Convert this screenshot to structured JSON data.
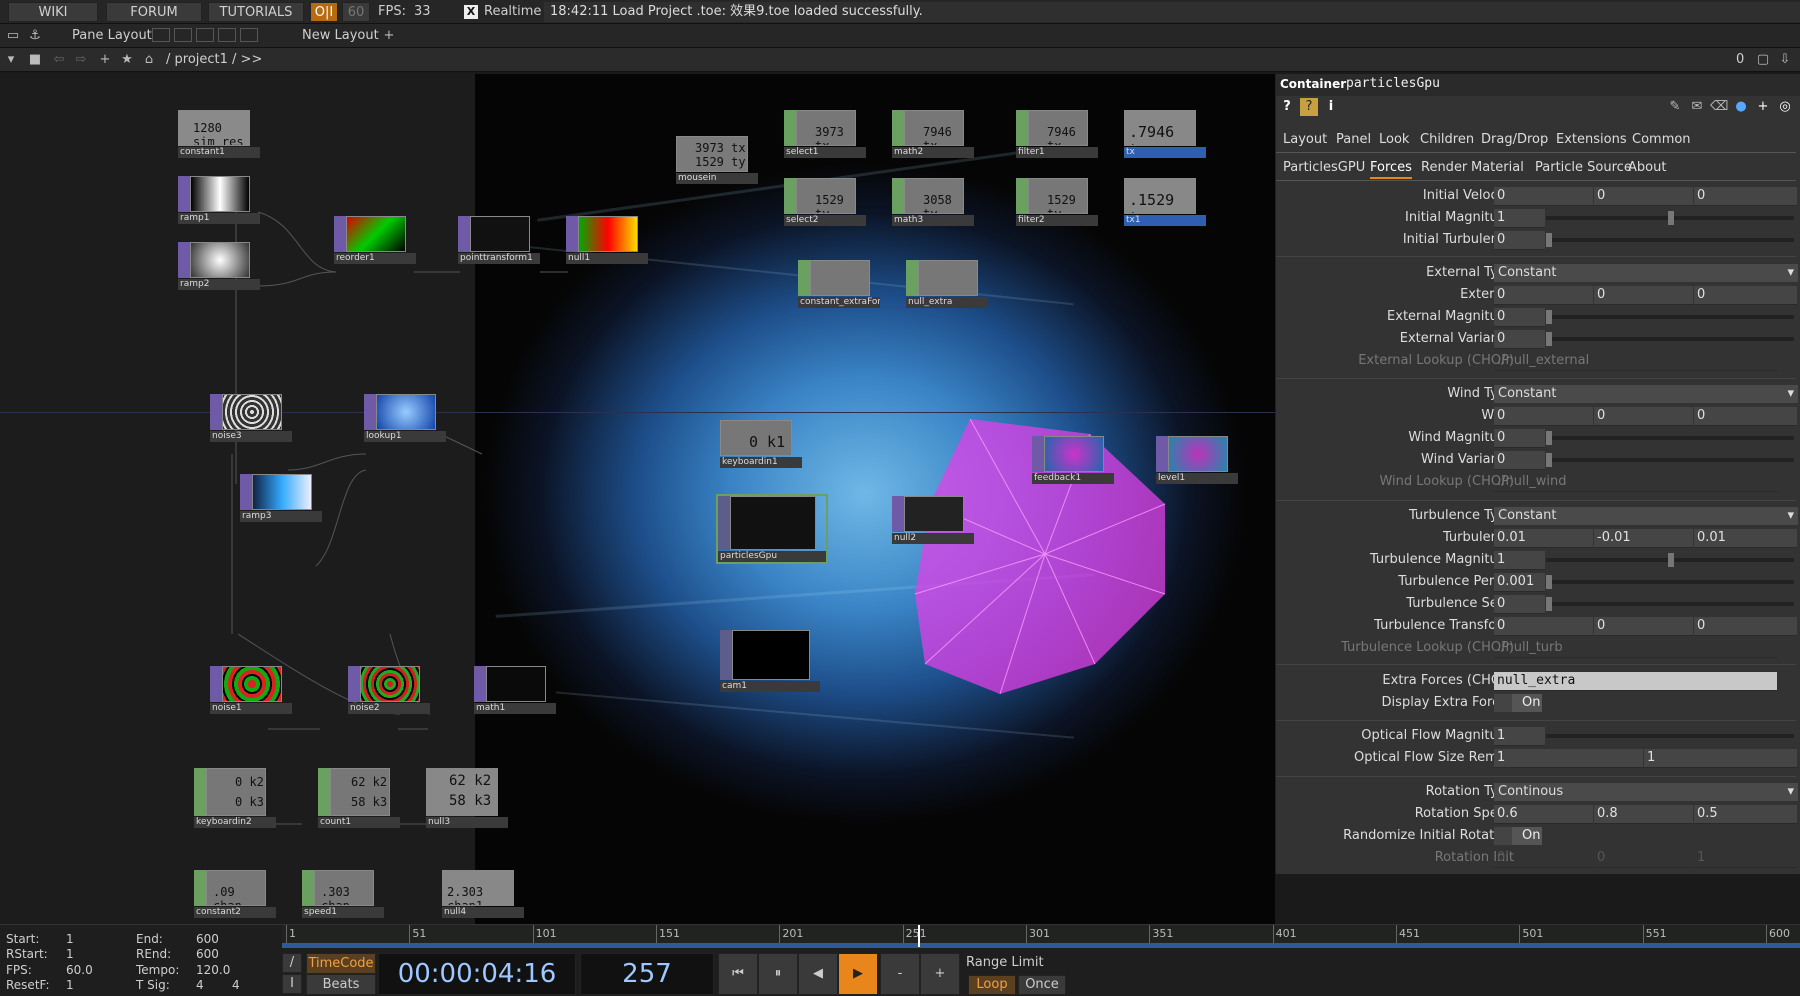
{
  "topbar": {
    "wiki": "WIKI",
    "forum": "FORUM",
    "tutorials": "TUTORIALS",
    "oi": "O|I",
    "fps_target": "60",
    "fps_label": "FPS:",
    "fps_value": "33",
    "realtime_check": "X",
    "realtime": "Realtime",
    "status": "18:42:11 Load Project .toe: 效果9.toe loaded successfully."
  },
  "layoutbar": {
    "pane_layout": "Pane Layout",
    "new_layout": "New Layout",
    "plus": "+"
  },
  "pathbar": {
    "path": "/ project1 / >>",
    "count": "0"
  },
  "nodes": {
    "constant1": {
      "label": "constant1",
      "value": "1280 sim_res"
    },
    "ramp1": {
      "label": "ramp1"
    },
    "ramp2": {
      "label": "ramp2"
    },
    "reorder1": {
      "label": "reorder1"
    },
    "pointtransform1": {
      "label": "pointtransform1"
    },
    "null1": {
      "label": "null1"
    },
    "mousein": {
      "label": "mousein",
      "v1": "3973 tx",
      "v2": "1529 ty"
    },
    "select1": {
      "label": "select1",
      "value": "3973 tx"
    },
    "math2": {
      "label": "math2",
      "value": "7946 tx"
    },
    "filter1": {
      "label": "filter1",
      "value": "7946 tx"
    },
    "tx": {
      "label": "tx",
      "value": ".7946 tx"
    },
    "select2": {
      "label": "select2",
      "value": "1529 ty"
    },
    "math3": {
      "label": "math3",
      "value": "3058 ty"
    },
    "filter2": {
      "label": "filter2",
      "value": "1529 ty"
    },
    "tx1": {
      "label": "tx1",
      "value": ".1529 ty"
    },
    "constant_extra": {
      "label": "constant_extraForce"
    },
    "null_extra": {
      "label": "null_extra"
    },
    "noise3": {
      "label": "noise3"
    },
    "lookup1": {
      "label": "lookup1"
    },
    "ramp3": {
      "label": "ramp3"
    },
    "keyboardin1": {
      "label": "keyboardin1",
      "value": "0 k1"
    },
    "particlesGpu": {
      "label": "particlesGpu"
    },
    "null2": {
      "label": "null2"
    },
    "feedback1": {
      "label": "feedback1"
    },
    "level1": {
      "label": "level1"
    },
    "cam1": {
      "label": "cam1"
    },
    "noise1": {
      "label": "noise1"
    },
    "noise2": {
      "label": "noise2"
    },
    "math1": {
      "label": "math1"
    },
    "keyboardin2": {
      "label": "keyboardin2",
      "v1": "0 k2",
      "v2": "0 k3"
    },
    "count1": {
      "label": "count1",
      "v1": "62 k2",
      "v2": "58 k3"
    },
    "null3": {
      "label": "null3",
      "v1": "62 k2",
      "v2": "58 k3"
    },
    "constant2": {
      "label": "constant2",
      "value": ".09 chan"
    },
    "speed1": {
      "label": "speed1",
      "value": ".303 chan"
    },
    "null4": {
      "label": "null4",
      "value": "2.303 chan1"
    }
  },
  "panel": {
    "type": "Container",
    "name": "particlesGpu",
    "tabs_row1": [
      "Layout",
      "Panel",
      "Look",
      "Children",
      "Drag/Drop",
      "Extensions",
      "Common"
    ],
    "tabs_row2": [
      "ParticlesGPU",
      "Forces",
      "Render",
      "Material",
      "Particle Source",
      "About"
    ],
    "active_tab": "Forces",
    "params": {
      "initial_velocity": {
        "label": "Initial Velocity",
        "v": [
          "0",
          "0",
          "0"
        ]
      },
      "initial_magnitude": {
        "label": "Initial Magnitude",
        "v": "1"
      },
      "initial_turbulence": {
        "label": "Initial Turbulence",
        "v": "0"
      },
      "external_type": {
        "label": "External Type",
        "v": "Constant"
      },
      "external": {
        "label": "External",
        "v": [
          "0",
          "0",
          "0"
        ]
      },
      "external_magnitude": {
        "label": "External Magnitude",
        "v": "0"
      },
      "external_variance": {
        "label": "External Variance",
        "v": "0"
      },
      "external_lookup": {
        "label": "External Lookup (CHOP)",
        "v": "./null_external"
      },
      "wind_type": {
        "label": "Wind Type",
        "v": "Constant"
      },
      "wind": {
        "label": "Wind",
        "v": [
          "0",
          "0",
          "0"
        ]
      },
      "wind_magnitude": {
        "label": "Wind Magnitude",
        "v": "0"
      },
      "wind_variance": {
        "label": "Wind Variance",
        "v": "0"
      },
      "wind_lookup": {
        "label": "Wind Lookup (CHOP)",
        "v": "./null_wind"
      },
      "turbulence_type": {
        "label": "Turbulence Type",
        "v": "Constant"
      },
      "turbulence": {
        "label": "Turbulence",
        "v": [
          "0.01",
          "-0.01",
          "0.01"
        ]
      },
      "turbulence_magnitude": {
        "label": "Turbulence Magnitude",
        "v": "1"
      },
      "turbulence_period": {
        "label": "Turbulence Period",
        "v": "0.001"
      },
      "turbulence_seed": {
        "label": "Turbulence Seed",
        "v": "0"
      },
      "turbulence_transform": {
        "label": "Turbulence Transform",
        "v": [
          "0",
          "0",
          "0"
        ]
      },
      "turbulence_lookup": {
        "label": "Turbulence Lookup (CHOP)",
        "v": "./null_turb"
      },
      "extra_forces": {
        "label": "Extra Forces (CHOP)",
        "v": "null_extra"
      },
      "display_extra": {
        "label": "Display Extra Forces",
        "v": "On"
      },
      "optical_flow_magnitude": {
        "label": "Optical Flow Magnitude",
        "v": "1"
      },
      "optical_flow_size": {
        "label": "Optical Flow Size Remap",
        "v": [
          "1",
          "1"
        ]
      },
      "rotation_type": {
        "label": "Rotation Type",
        "v": "Continous"
      },
      "rotation_speed": {
        "label": "Rotation Speed",
        "v": [
          "0.6",
          "0.8",
          "0.5"
        ]
      },
      "randomize_rotation": {
        "label": "Randomize Initial Rotation",
        "v": "On"
      },
      "rotation_init": {
        "label": "Rotation Init",
        "v": [
          "0",
          "0",
          "1"
        ]
      }
    }
  },
  "timeline": {
    "start_label": "Start:",
    "start": "1",
    "end_label": "End:",
    "end": "600",
    "rstart_label": "RStart:",
    "rstart": "1",
    "rend_label": "REnd:",
    "rend": "600",
    "fps_label": "FPS:",
    "fps": "60.0",
    "tempo_label": "Tempo:",
    "tempo": "120.0",
    "resetf_label": "ResetF:",
    "resetf": "1",
    "tsig_label": "T Sig:",
    "tsig1": "4",
    "tsig2": "4",
    "ticks": [
      "1",
      "51",
      "101",
      "151",
      "201",
      "251",
      "301",
      "351",
      "401",
      "451",
      "501",
      "551",
      "600"
    ],
    "timecode_btn": "TimeCode",
    "beats_btn": "Beats",
    "timecode": "00:00:04:16",
    "frame": "257",
    "minus": "-",
    "plus": "+",
    "range_limit": "Range Limit",
    "loop": "Loop",
    "once": "Once",
    "slash": "/",
    "pipe": "I",
    "current_fraction": 0.427
  },
  "colors": {
    "accent_orange": "#e8861b",
    "top_purple": "#6e5aa6",
    "chop_green": "#6aa060",
    "magenta": "#e040e8"
  }
}
